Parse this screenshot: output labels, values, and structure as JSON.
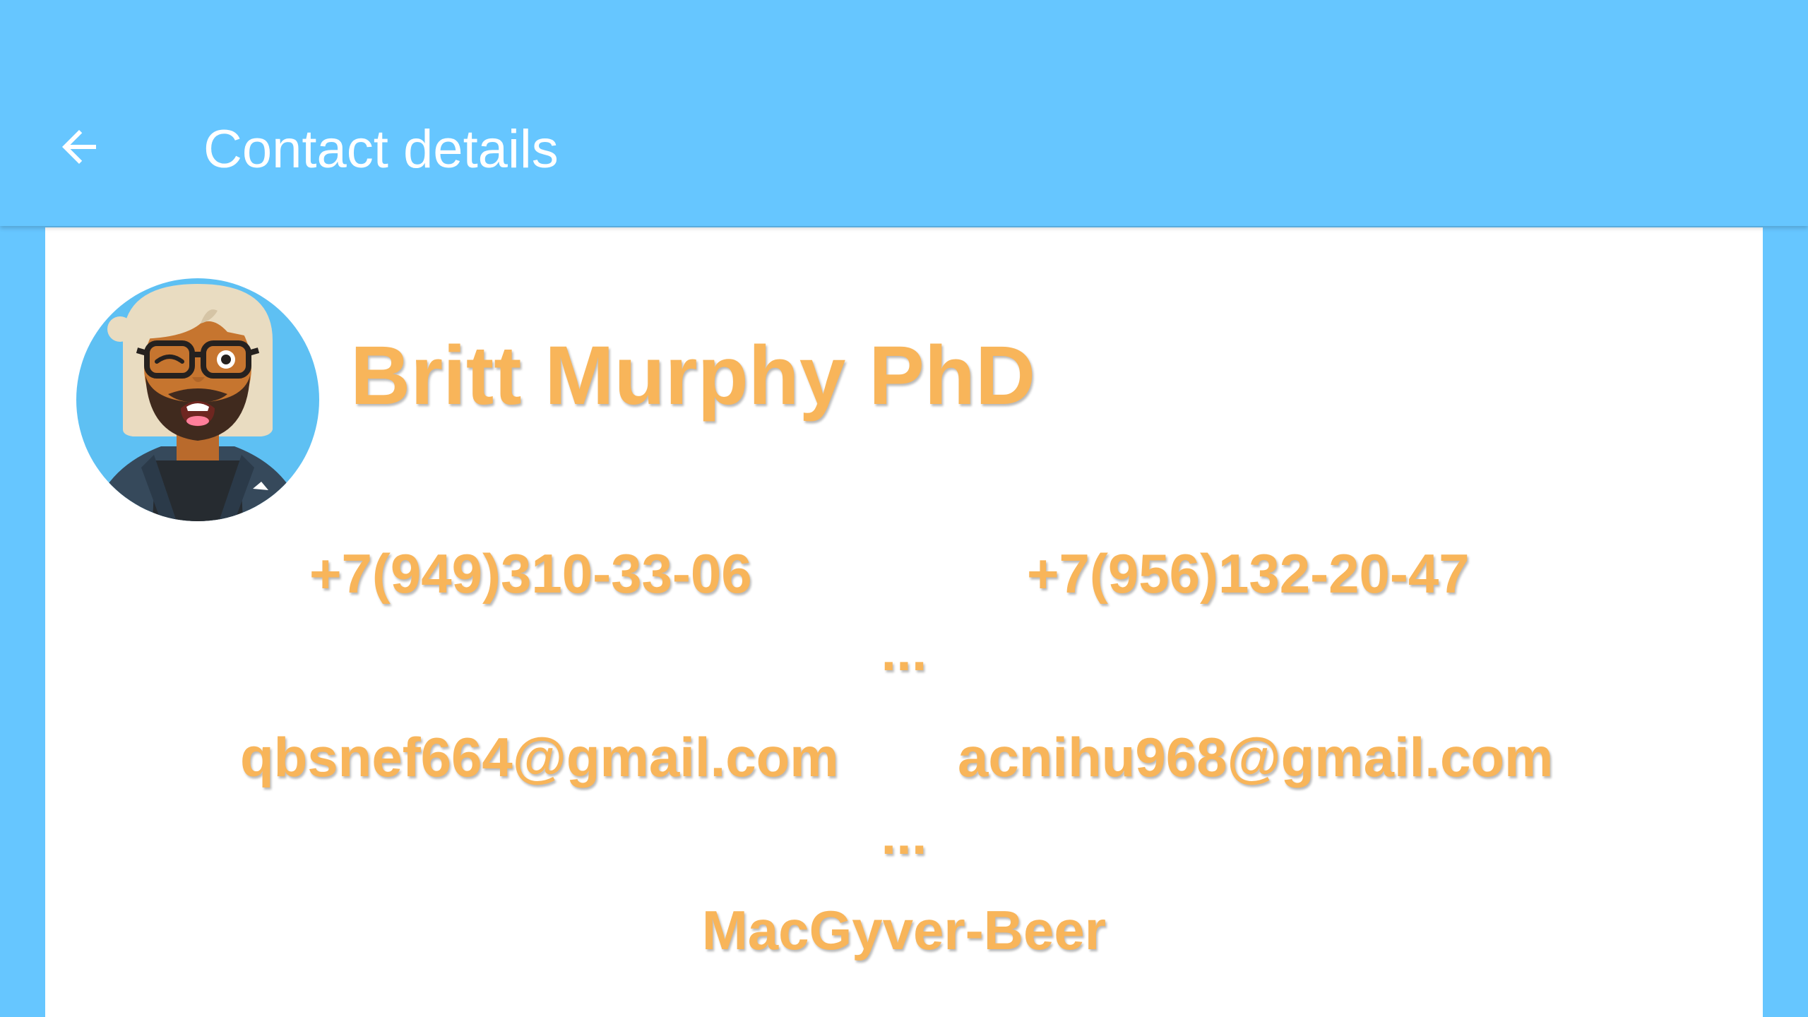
{
  "app_bar": {
    "title": "Contact details",
    "back_icon": "arrow-back-icon",
    "background_color": "#66c6ff"
  },
  "contact": {
    "avatar_icon": "person-avatar-icon",
    "name": "Britt Murphy PhD",
    "phones": [
      "+7(949)310-33-06",
      "+7(956)132-20-47"
    ],
    "phones_more": "...",
    "emails": [
      "qbsnef664@gmail.com",
      "acnihu968@gmail.com"
    ],
    "emails_more": "...",
    "company": "MacGyver-Beer",
    "text_color": "#f8b55a"
  }
}
